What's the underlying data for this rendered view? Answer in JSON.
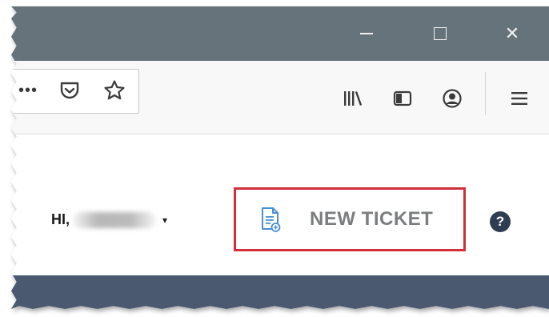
{
  "window": {
    "minimize_icon": "minimize-icon",
    "maximize_icon": "maximize-icon",
    "close_icon": "close-icon",
    "close_glyph": "✕"
  },
  "toolbar": {
    "overflow_glyph": "•••",
    "icons": [
      "more-icon",
      "pocket-icon",
      "star-icon",
      "library-icon",
      "sidebar-icon",
      "account-icon",
      "menu-icon"
    ]
  },
  "header": {
    "greeting": "HI,",
    "user_caret": "▾",
    "new_ticket_label": "NEW TICKET",
    "help_glyph": "?"
  },
  "colors": {
    "titlebar": "#67737a",
    "highlight_border": "#d32f3a",
    "nav": "#4a5970",
    "help_bg": "#2e3d52",
    "ticket_icon": "#4a8fd4"
  }
}
